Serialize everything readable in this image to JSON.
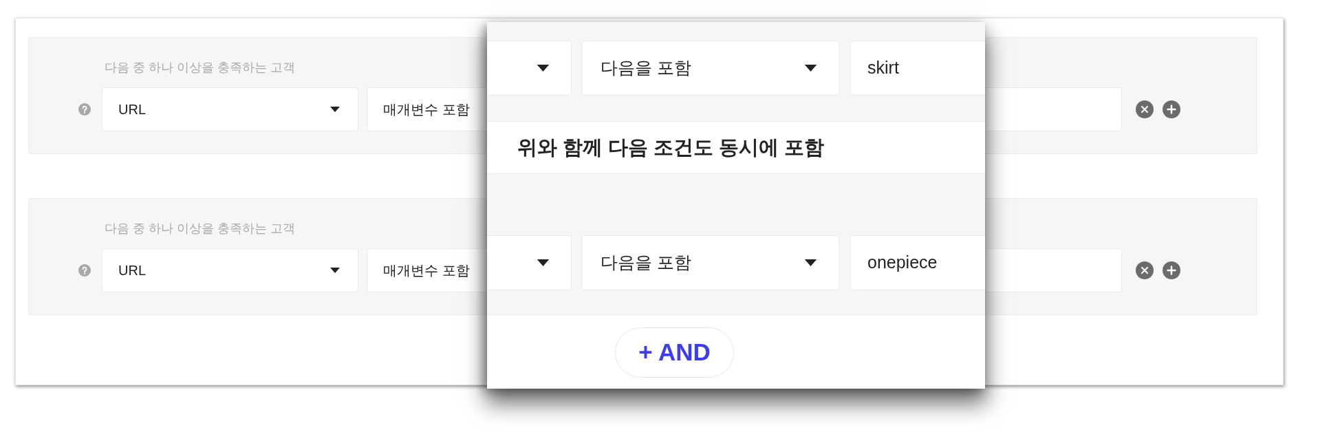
{
  "groups": [
    {
      "label": "다음 중 하나 이상을 충족하는 고객",
      "fields": [
        {
          "kind": "dropdown",
          "value": "URL"
        },
        {
          "kind": "field",
          "value": "매개변수 포함"
        },
        {
          "kind": "field"
        }
      ]
    },
    {
      "label": "다음 중 하나 이상을 충족하는 고객",
      "fields": [
        {
          "kind": "dropdown",
          "value": "URL"
        },
        {
          "kind": "field",
          "value": "매개변수 포함"
        },
        {
          "kind": "field"
        }
      ]
    }
  ],
  "magnified_view": {
    "sections": [
      {
        "kind": "conditions",
        "fields": [
          {
            "kind": "dropdown"
          },
          {
            "kind": "dropdown",
            "value": "다음을 포함"
          },
          {
            "kind": "field",
            "value": "skirt"
          }
        ]
      },
      {
        "kind": "banner",
        "text": "위와 함께 다음 조건도 동시에 포함"
      },
      {
        "kind": "conditions",
        "fields": [
          {
            "kind": "dropdown"
          },
          {
            "kind": "dropdown",
            "value": "다음을 포함"
          },
          {
            "kind": "field",
            "value": "onepiece"
          }
        ]
      },
      {
        "kind": "footer",
        "button": "+ AND"
      }
    ]
  }
}
